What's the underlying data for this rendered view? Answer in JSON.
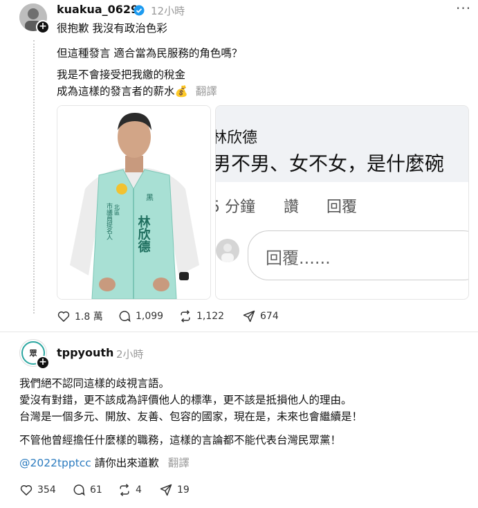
{
  "post1": {
    "username": "kuakua_0629",
    "time": "12小時",
    "line1": "很抱歉 我沒有政治色彩",
    "line2": "但這種發言 適合當為民服務的角色嗎？",
    "line3": "我是不會接受把我繳的稅金",
    "line4": "成為這樣的發言者的薪水💰",
    "translate": "翻譯",
    "image1": {
      "vest_name": "林欣德",
      "vest_side": "市議員提名人",
      "vest_district": "北區"
    },
    "image2": {
      "name": "林欣德",
      "comment": "男不男、女不女，是什麼碗",
      "time_ago": "5 分鐘",
      "like": "讚",
      "reply": "回覆",
      "reply_placeholder": "回覆......"
    },
    "stats": {
      "likes": "1.8 萬",
      "comments": "1,099",
      "reposts": "1,122",
      "shares": "674"
    }
  },
  "post2": {
    "username": "tppyouth",
    "time": "2小時",
    "p1": "我們絕不認同這樣的歧視言語。",
    "p2": "愛沒有對錯，更不該成為評價他人的標準，更不該是抵損他人的理由。",
    "p3": "台灣是一個多元、開放、友善、包容的國家，現在是，未來也會繼續是！",
    "p4": "不管他曾經擔任什麼樣的職務，這樣的言論都不能代表台灣民眾黨！",
    "mention": "@2022tpptcc",
    "mention_text": " 請你出來道歉",
    "translate": "翻譯",
    "stats": {
      "likes": "354",
      "comments": "61",
      "reposts": "4",
      "shares": "19"
    }
  },
  "colors": {
    "link": "#2b7bbf",
    "verified": "#1d9bf0",
    "vest": "#a8e0d4"
  }
}
